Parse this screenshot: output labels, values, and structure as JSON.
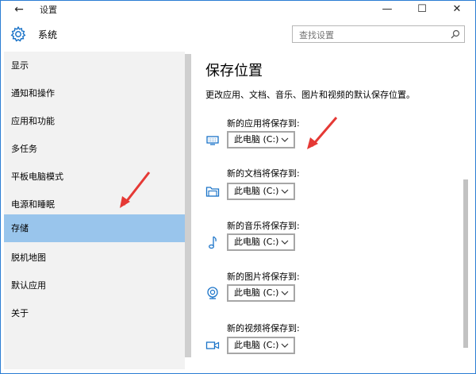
{
  "window": {
    "title": "设置",
    "back_glyph": "←",
    "minimize_glyph": "—",
    "maximize_glyph": "☐",
    "close_glyph": "✕"
  },
  "header": {
    "title": "系统",
    "search_placeholder": "查找设置"
  },
  "sidebar": {
    "items": [
      {
        "label": "显示"
      },
      {
        "label": "通知和操作"
      },
      {
        "label": "应用和功能"
      },
      {
        "label": "多任务"
      },
      {
        "label": "平板电脑模式"
      },
      {
        "label": "电源和睡眠"
      },
      {
        "label": "存储",
        "selected": true
      },
      {
        "label": "脱机地图"
      },
      {
        "label": "默认应用"
      },
      {
        "label": "关于"
      }
    ]
  },
  "content": {
    "title": "保存位置",
    "description": "更改应用、文档、音乐、图片和视频的默认保存位置。",
    "locations": [
      {
        "label": "新的应用将保存到:",
        "value": "此电脑 (C:)",
        "icon": "monitor-icon"
      },
      {
        "label": "新的文档将保存到:",
        "value": "此电脑 (C:)",
        "icon": "folder-icon"
      },
      {
        "label": "新的音乐将保存到:",
        "value": "此电脑 (C:)",
        "icon": "music-note-icon"
      },
      {
        "label": "新的图片将保存到:",
        "value": "此电脑 (C:)",
        "icon": "camera-icon"
      },
      {
        "label": "新的视频将保存到:",
        "value": "此电脑 (C:)",
        "icon": "video-icon"
      }
    ]
  },
  "colors": {
    "accent": "#1a73c8",
    "selected_bg": "#99c5ec",
    "sidebar_bg": "#f2f2f2",
    "annotation": "#e53935"
  }
}
